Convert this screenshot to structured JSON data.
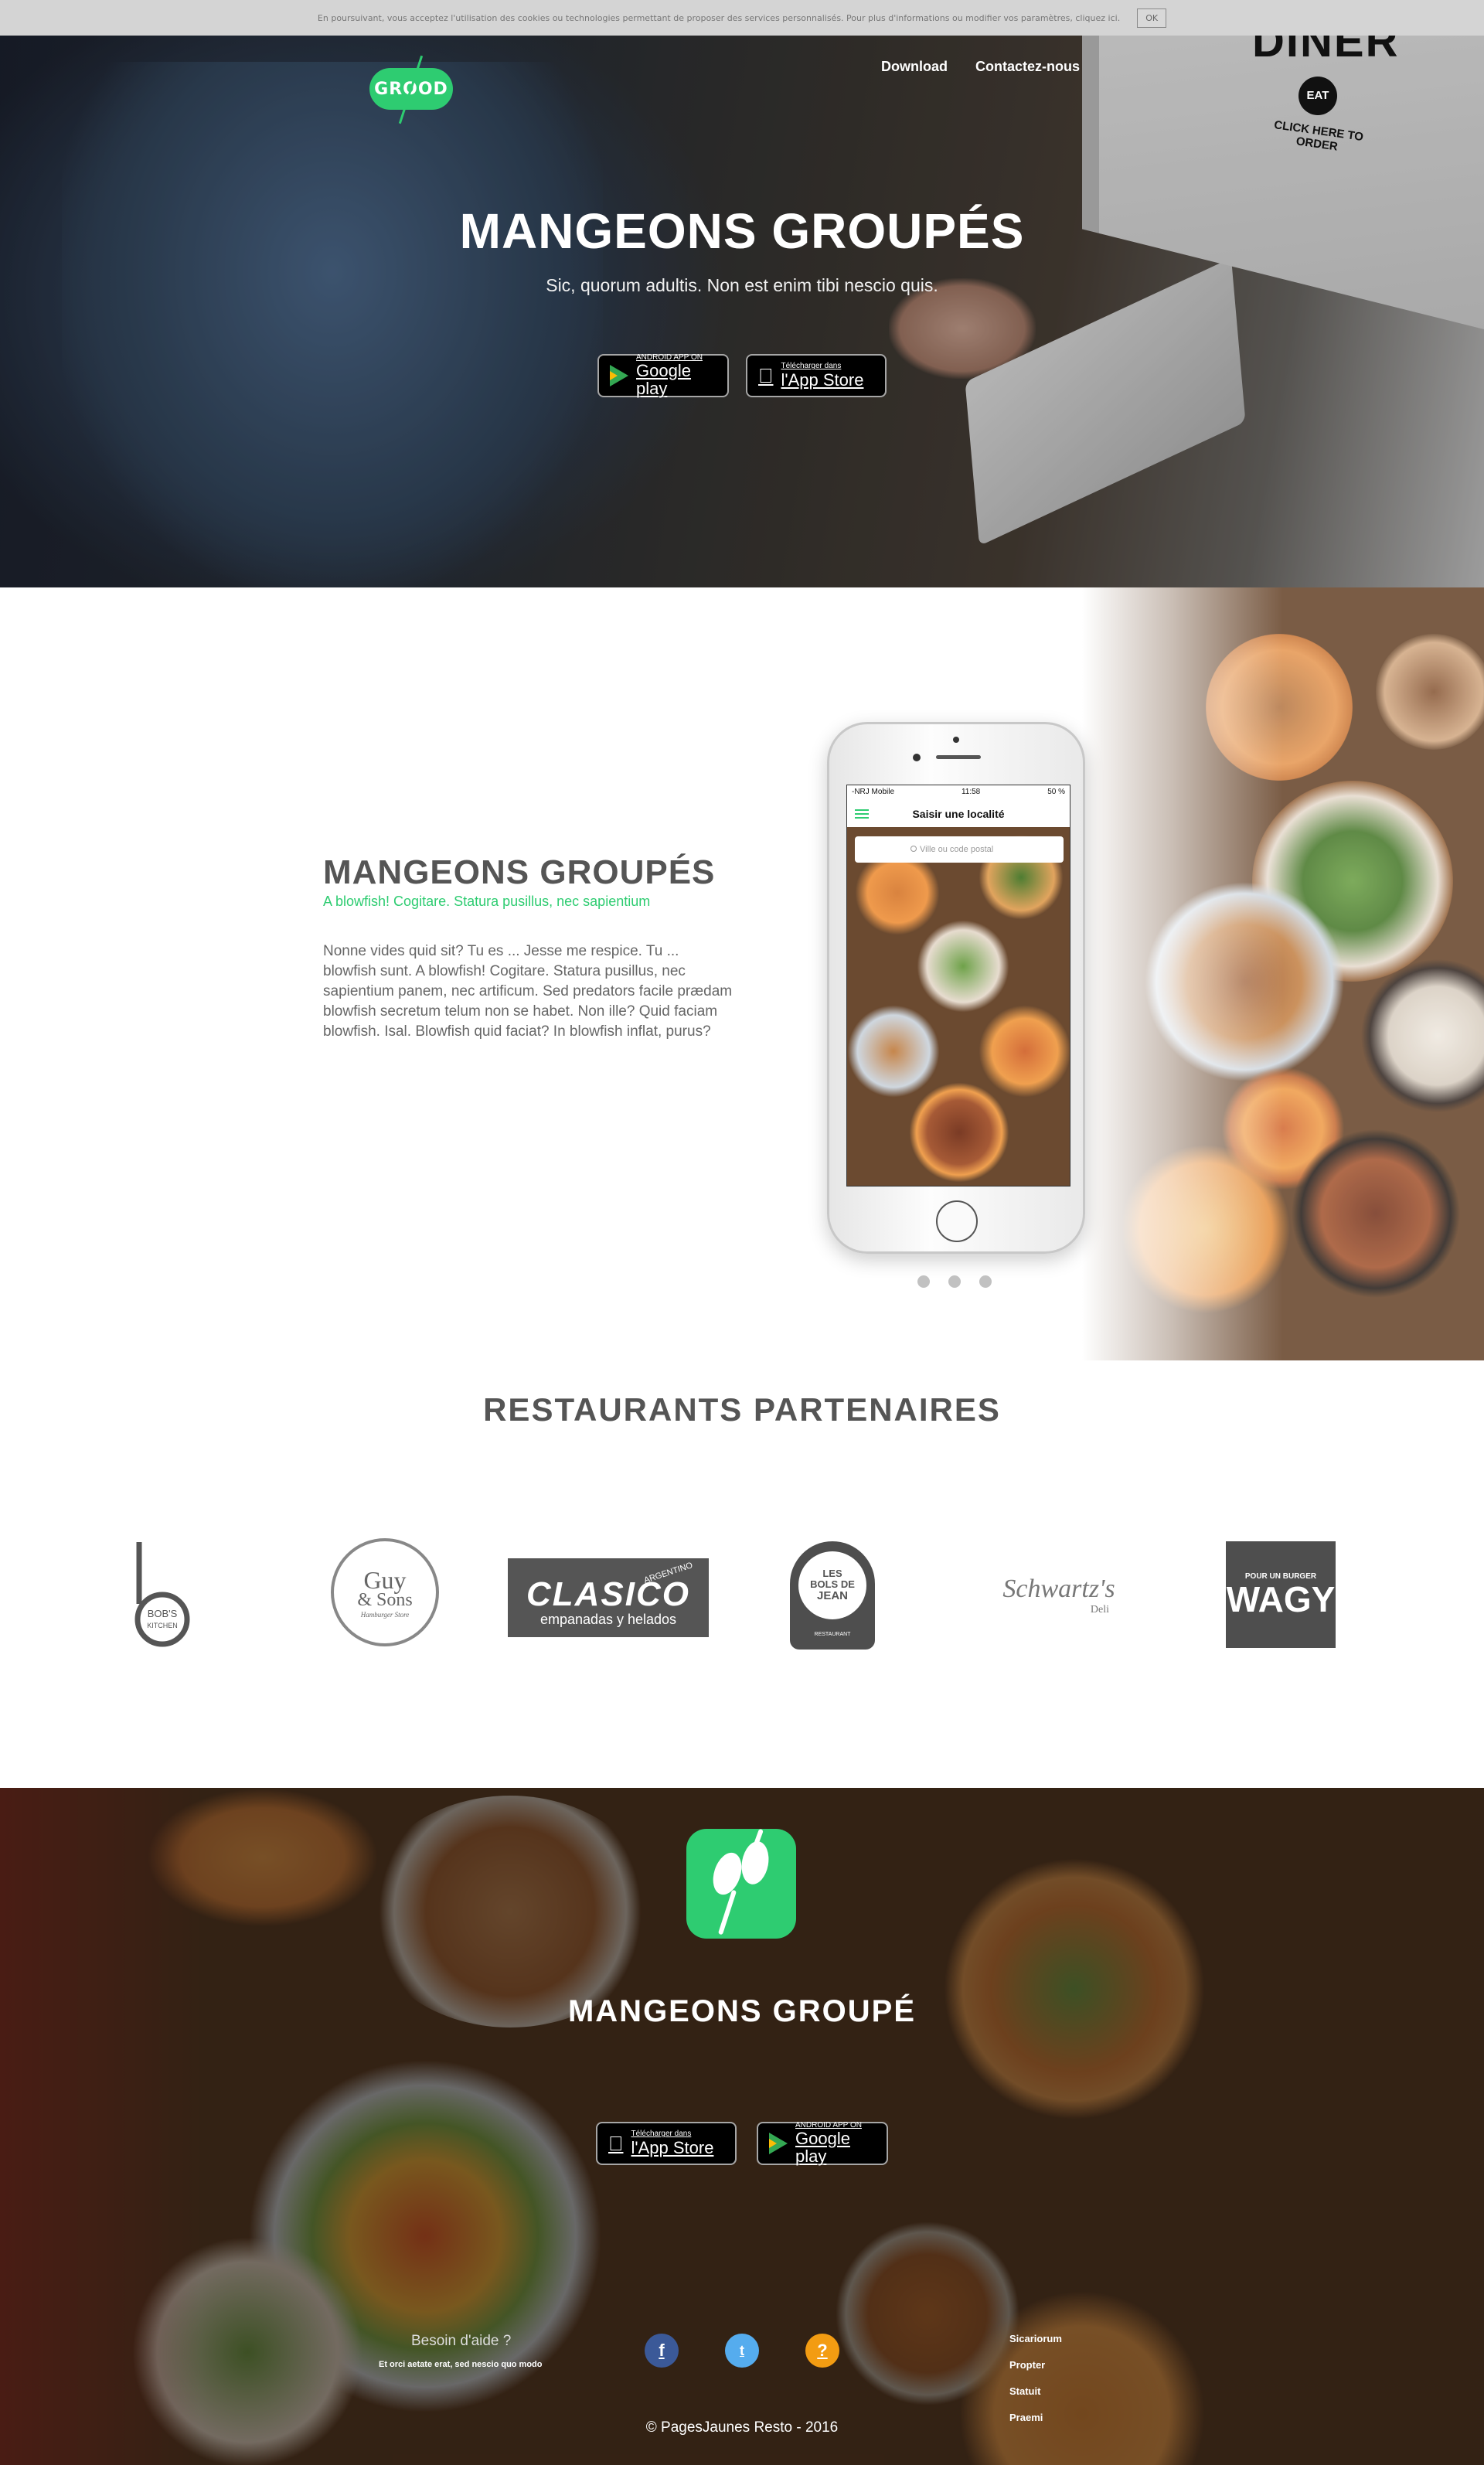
{
  "cookie": {
    "text": "En poursuivant, vous acceptez l'utilisation des cookies ou technologies permettant de proposer des services personnalisés. Pour plus d'informations ou modifier vos paramètres, cliquez ici.",
    "ok_label": "OK"
  },
  "header": {
    "logo_text": "GROOD",
    "nav": [
      {
        "label": "Download"
      },
      {
        "label": "Contactez-nous"
      }
    ]
  },
  "hero": {
    "title": "MANGEONS GROUPÉS",
    "subtitle": "Sic, quorum adultis. Non est enim tibi nescio quis.",
    "monitor_text": {
      "line1": "DINER",
      "badge": "EAT",
      "line2": "CLICK HERE TO ORDER"
    }
  },
  "stores": {
    "google": {
      "small": "ANDROID APP ON",
      "big": "Google play"
    },
    "apple": {
      "small": "Télécharger dans",
      "big": "l'App Store"
    }
  },
  "feature": {
    "title": "MANGEONS GROUPÉS",
    "subtitle": "A blowfish! Cogitare. Statura pusillus, nec sapientium",
    "body": "Nonne vides quid sit? Tu es ... Jesse me respice. Tu ... blowfish sunt. A blowfish! Cogitare. Statura pusillus, nec sapientium panem, nec artificum. Sed predators facile prædam blowfish secretum telum non se habet. Non ille? Quid faciam blowfish. Isal. Blowfish quid faciat? In blowfish inflat, purus?"
  },
  "phone": {
    "carrier": "-NRJ Mobile",
    "time": "11:58",
    "battery": "50 %",
    "header_title": "Saisir une localité",
    "search_placeholder": "Ville ou code postal"
  },
  "partners": {
    "title": "RESTAURANTS PARTENAIRES",
    "logos": [
      {
        "name": "BOB'S KITCHEN"
      },
      {
        "name": "Guy & Sons",
        "line1": "Guy",
        "line2": "& Sons",
        "tag": "Hamburger Store"
      },
      {
        "name": "CLASICO",
        "line1": "CLASICO",
        "tag": "ARGENTINO",
        "line2": "empanadas y helados"
      },
      {
        "name": "LES BOLS DE JEAN",
        "line1": "LES",
        "line2": "BOLS DE",
        "line3": "JEAN",
        "tag": "RESTAURANT"
      },
      {
        "name": "Schwartz's",
        "line1": "Schwartz's",
        "line2": "Deli"
      },
      {
        "name": "WAGY",
        "tag": "POUR UN BURGER",
        "line1": "WAGY"
      }
    ]
  },
  "footer": {
    "title": "MANGEONS GROUPÉ",
    "help_title": "Besoin d'aide ?",
    "help_sub": "Et orci aetate erat, sed nescio quo modo",
    "social": [
      {
        "name": "facebook",
        "glyph": "f"
      },
      {
        "name": "twitter",
        "glyph": "t"
      },
      {
        "name": "help",
        "glyph": "?"
      }
    ],
    "links": [
      {
        "label": "Sicariorum"
      },
      {
        "label": "Propter"
      },
      {
        "label": "Statuit"
      },
      {
        "label": "Praemi"
      }
    ],
    "copyright": "© PagesJaunes Resto - 2016"
  },
  "colors": {
    "brand_green": "#2ecc71",
    "facebook": "#3b5998",
    "twitter": "#55acee",
    "help_orange": "#f39c12"
  }
}
